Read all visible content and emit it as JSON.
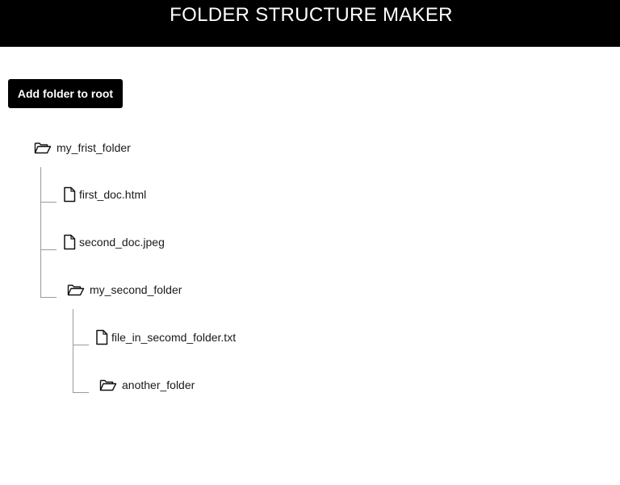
{
  "header": {
    "title": "FOLDER STRUCTURE MAKER"
  },
  "toolbar": {
    "add_root_label": "Add folder to root"
  },
  "tree": {
    "items": [
      {
        "type": "folder",
        "label": "my_frist_folder",
        "icon": "folder-open-icon"
      },
      {
        "type": "file",
        "label": "first_doc.html",
        "icon": "file-icon"
      },
      {
        "type": "file",
        "label": "second_doc.jpeg",
        "icon": "file-icon"
      },
      {
        "type": "folder",
        "label": "my_second_folder",
        "icon": "folder-open-icon"
      },
      {
        "type": "file",
        "label": "file_in_secomd_folder.txt",
        "icon": "file-icon"
      },
      {
        "type": "folder",
        "label": "another_folder",
        "icon": "folder-open-icon"
      }
    ]
  },
  "colors": {
    "header_bg": "#000000",
    "header_text": "#ffffff",
    "button_bg": "#000000",
    "button_text": "#ffffff",
    "connector_line": "#9a9a9a"
  }
}
